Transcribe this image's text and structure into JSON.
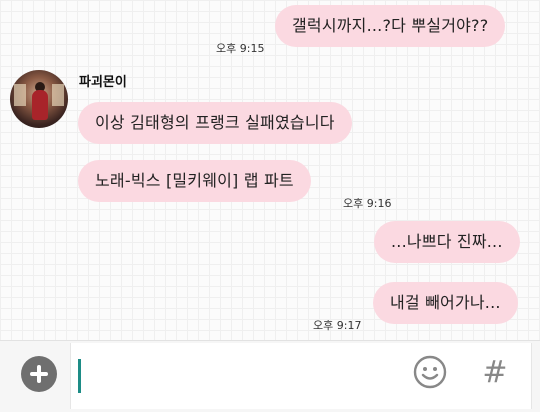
{
  "messages": [
    {
      "text": "갤럭시까지...?다 뿌실거야??",
      "side": "outgoing"
    },
    {
      "text": "이상 김태형의 프랭크 실패였습니다",
      "side": "incoming"
    },
    {
      "text": "노래-빅스 [밀키웨이] 랩 파트",
      "side": "incoming"
    },
    {
      "text": "...나쁘다 진짜...",
      "side": "outgoing"
    },
    {
      "text": "내걸 빼어가나...",
      "side": "outgoing"
    }
  ],
  "timestamps": {
    "t1": "오후 9:15",
    "t2": "오후 9:16",
    "t3": "오후 9:17"
  },
  "sender": {
    "name": "파괴몬이"
  },
  "input": {
    "value": "",
    "hash_label": "#"
  },
  "icons": {
    "attach": "plus-circle-icon",
    "emoji": "smiley-icon",
    "hashtag": "hashtag-icon"
  },
  "colors": {
    "bubble": "#fbd9e1",
    "caret": "#1d8c86"
  }
}
